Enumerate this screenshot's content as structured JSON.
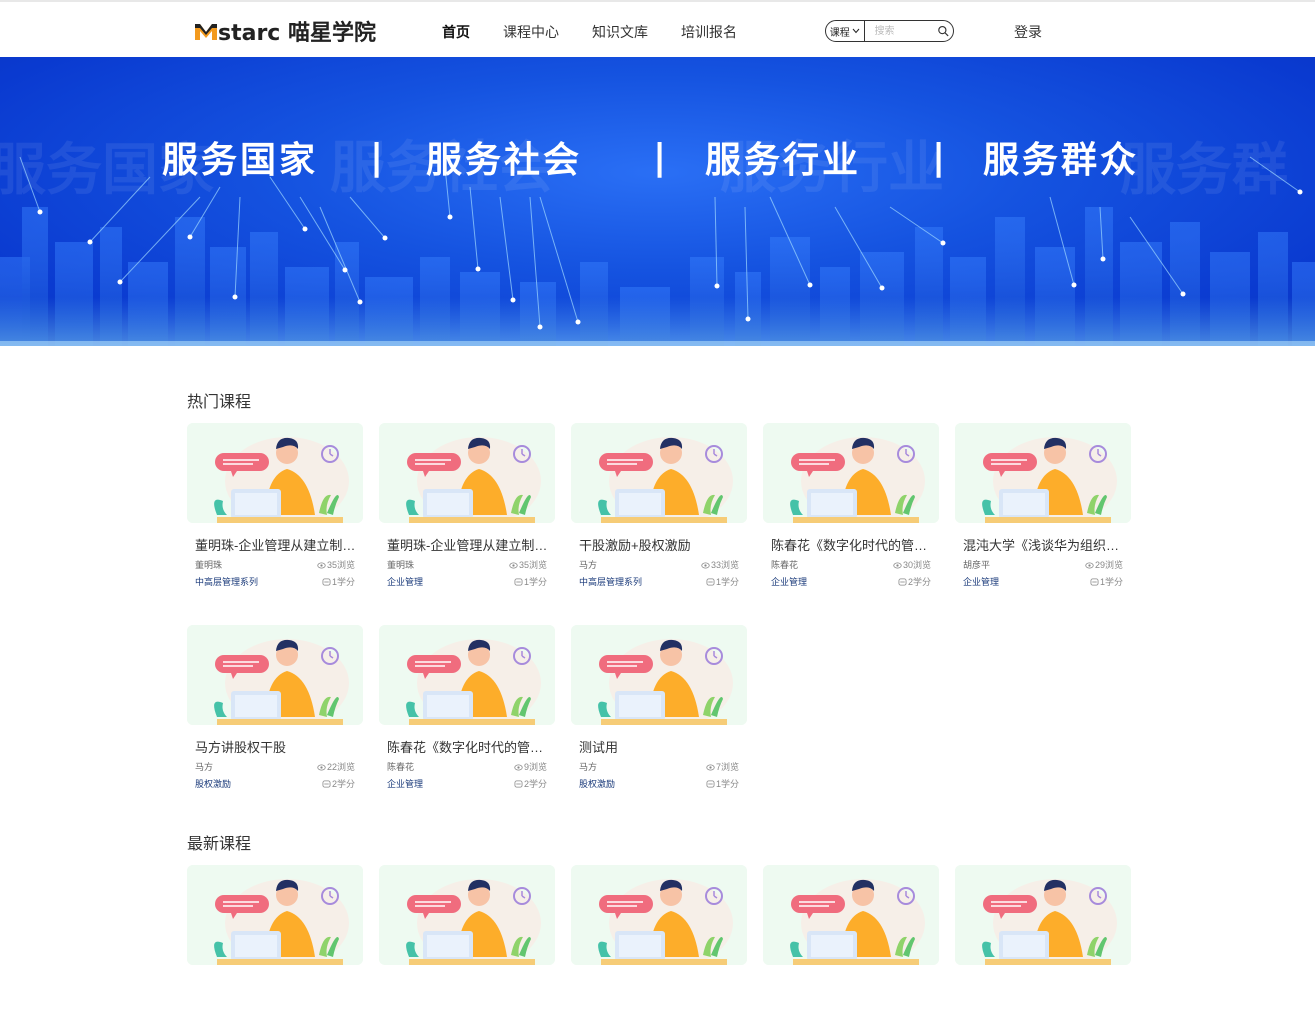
{
  "header": {
    "logo_text": "starc 喵星学院",
    "nav": [
      "首页",
      "课程中心",
      "知识文库",
      "培训报名"
    ],
    "search_select": "课程",
    "search_placeholder": "搜索",
    "login": "登录"
  },
  "banner": {
    "slogans": [
      "服务国家",
      "服务社会",
      "服务行业",
      "服务群众"
    ],
    "separator": "|"
  },
  "hot": {
    "title": "热门课程",
    "courses": [
      {
        "title": "董明珠-企业管理从建立制度到...",
        "teacher": "董明珠",
        "views": "35浏览",
        "category": "中高层管理系列",
        "credits": "1学分"
      },
      {
        "title": "董明珠-企业管理从建立制度到...",
        "teacher": "董明珠",
        "views": "35浏览",
        "category": "企业管理",
        "credits": "1学分"
      },
      {
        "title": "干股激励+股权激励",
        "teacher": "马方",
        "views": "33浏览",
        "category": "中高层管理系列",
        "credits": "1学分"
      },
      {
        "title": "陈春花《数字化时代的管理》",
        "teacher": "陈春花",
        "views": "30浏览",
        "category": "企业管理",
        "credits": "2学分"
      },
      {
        "title": "混沌大学《浅谈华为组织架构》",
        "teacher": "胡彦平",
        "views": "29浏览",
        "category": "企业管理",
        "credits": "1学分"
      },
      {
        "title": "马方讲股权干股",
        "teacher": "马方",
        "views": "22浏览",
        "category": "股权激励",
        "credits": "2学分"
      },
      {
        "title": "陈春花《数字化时代的管理》",
        "teacher": "陈春花",
        "views": "9浏览",
        "category": "企业管理",
        "credits": "2学分"
      },
      {
        "title": "测试用",
        "teacher": "马方",
        "views": "7浏览",
        "category": "股权激励",
        "credits": "1学分"
      }
    ]
  },
  "latest": {
    "title": "最新课程"
  },
  "icons": {
    "eye": "eye-icon",
    "credit": "credit-icon",
    "search": "search-icon",
    "chevron": "chevron-down-icon"
  },
  "colors": {
    "banner_blue": "#1553e0",
    "thumb_bg": "#eefaf1",
    "category_text": "#1a3a7a"
  }
}
